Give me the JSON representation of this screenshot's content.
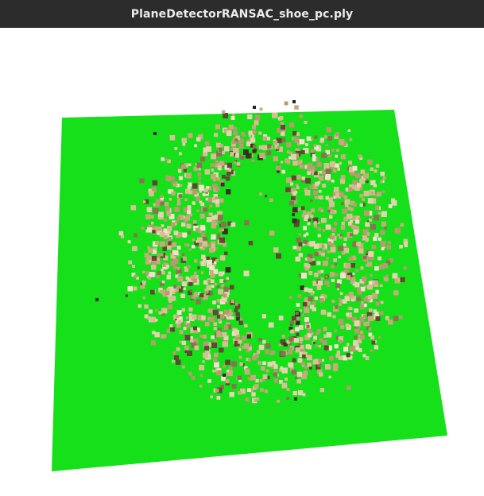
{
  "window": {
    "title": "PlaneDetectorRANSAC_shoe_pc.ply"
  },
  "scene": {
    "background_color": "#ffffff",
    "plane_color": "#15e01a",
    "point_palette": [
      "#d9bf95",
      "#c9aa7c",
      "#e6d3b1",
      "#b99b70",
      "#8a7252",
      "#5e4a33",
      "#3b2f22",
      "#f0e4cc",
      "#a8895f",
      "#6f5b42"
    ]
  }
}
